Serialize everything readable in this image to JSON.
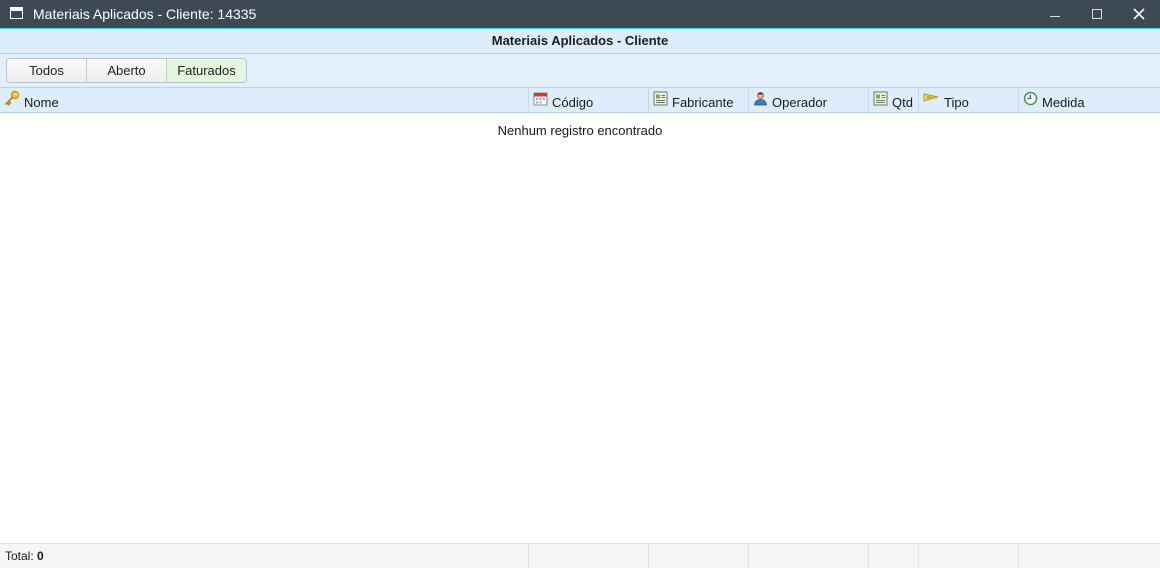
{
  "window": {
    "title": "Materiais Aplicados - Cliente: 14335",
    "icons": [
      "app-window-icon",
      "minimize-icon",
      "maximize-icon",
      "close-icon"
    ]
  },
  "panel": {
    "header": "Materiais Aplicados - Cliente"
  },
  "toolbar": {
    "filters": [
      {
        "label": "Todos",
        "active": false
      },
      {
        "label": "Aberto",
        "active": false
      },
      {
        "label": "Faturados",
        "active": true
      }
    ]
  },
  "columns": [
    {
      "label": "Nome",
      "icon": "key-icon"
    },
    {
      "label": "Código",
      "icon": "calendar-icon"
    },
    {
      "label": "Fabricante",
      "icon": "report-icon"
    },
    {
      "label": "Operador",
      "icon": "user-icon"
    },
    {
      "label": "Qtd",
      "icon": "report-icon"
    },
    {
      "label": "Tipo",
      "icon": "flag-icon"
    },
    {
      "label": "Medida",
      "icon": "clock-icon"
    }
  ],
  "grid": {
    "empty_message": "Nenhum registro encontrado"
  },
  "footer": {
    "total_label": "Total:",
    "total_value": "0"
  },
  "colors": {
    "titlebar": "#3d4a55",
    "header_bg": "#deedfb",
    "toolbar_bg": "#e3f0fc",
    "active_filter": "#e4f7de",
    "accent_line": "#56d0e6"
  }
}
